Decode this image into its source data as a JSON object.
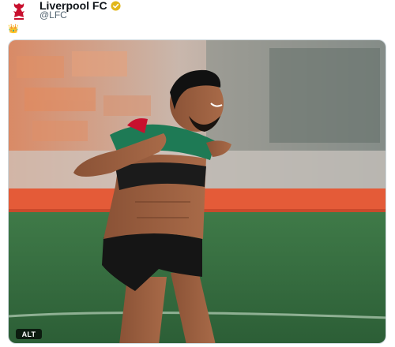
{
  "post": {
    "display_name": "Liverpool FC",
    "handle": "@LFC",
    "emoji_text": "👑"
  },
  "media": {
    "alt_label": "ALT"
  },
  "icons": {
    "avatar": "lfc-crest-icon",
    "verified": "verified-badge-icon"
  },
  "colors": {
    "brand_red": "#c8102e",
    "verified_gold": "#e2b719",
    "pitch_green": "#2f6b3c"
  }
}
